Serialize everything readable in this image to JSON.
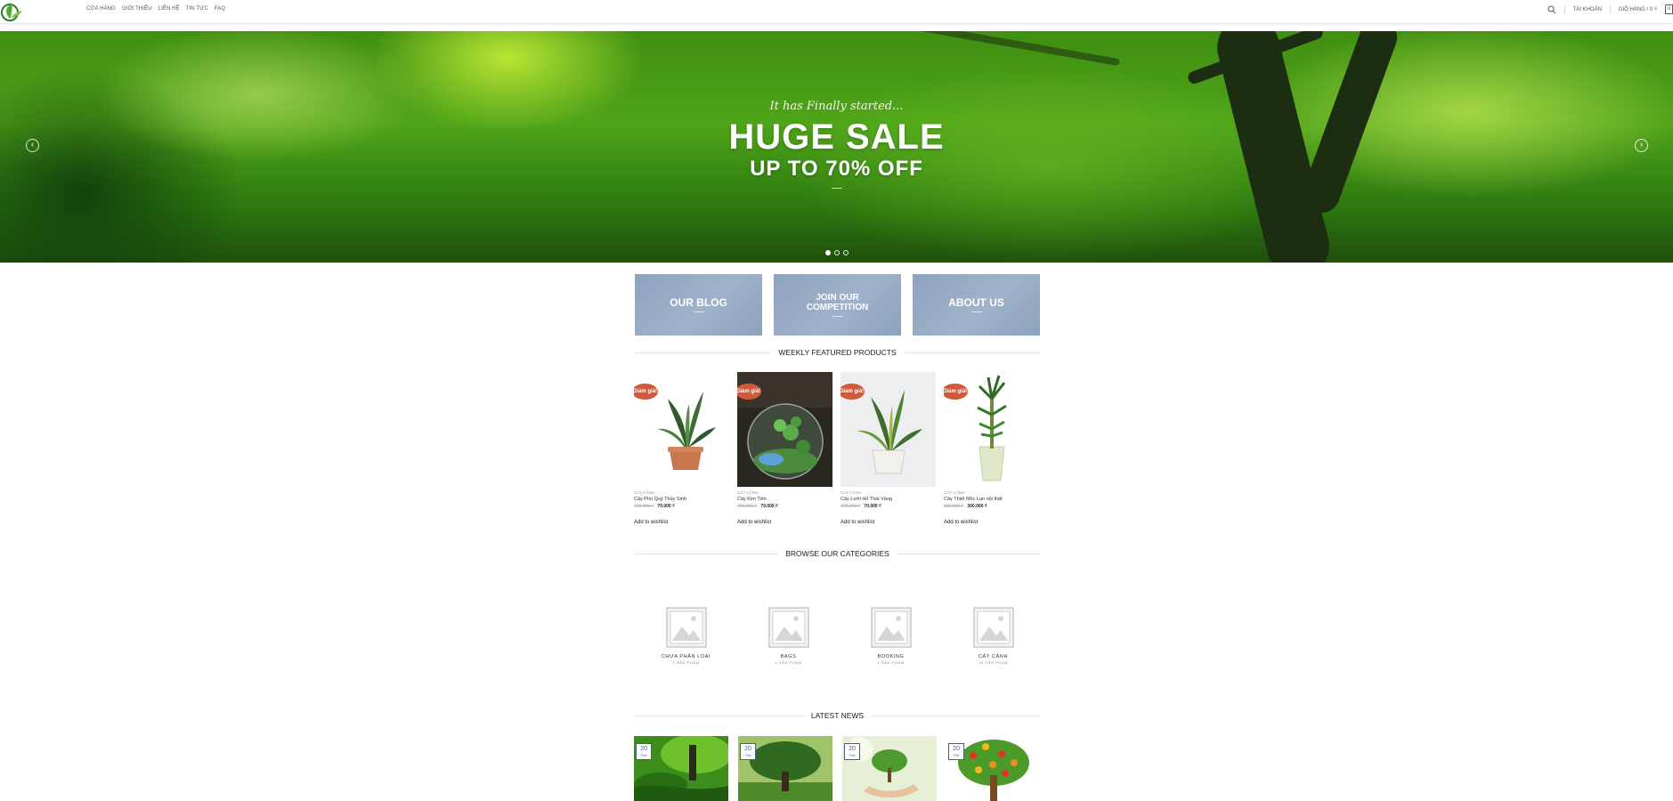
{
  "header": {
    "nav": [
      "CỬA HÀNG",
      "GIỚI THIỆU",
      "LIÊN HỆ",
      "TIN TỨC",
      "FAQ"
    ],
    "account_label": "TÀI KHOẢN",
    "cart_label": "GIỎ HÀNG / 0 ₫",
    "cart_count": "0"
  },
  "hero": {
    "tagline": "It has Finally started...",
    "title": "HUGE SALE",
    "subtitle": "UP TO 70% OFF",
    "prev_arrow": "‹",
    "next_arrow": "›",
    "slide_count": 3,
    "active_slide": 1
  },
  "banners": {
    "blog": "OUR BLOG",
    "competition_line1": "JOIN OUR",
    "competition_line2": "COMPETITION",
    "about": "ABOUT US"
  },
  "featured": {
    "title": "WEEKLY FEATURED PRODUCTS",
    "badge": "Giảm giá!",
    "wishlist_label": "Add to wishlist",
    "products": [
      {
        "category": "CÂY CẢNH",
        "name": "Cây Phú Quý Thủy Sinh",
        "old_price": "449.000 ₫",
        "new_price": "70.000 ₫"
      },
      {
        "category": "CÂY CẢNH",
        "name": "Cây Kim Tiền",
        "old_price": "440.000 ₫",
        "new_price": "70.000 ₫"
      },
      {
        "category": "CÂY CẢNH",
        "name": "Cây Lưỡi Hổ Thái Vàng",
        "old_price": "449.000 ₫",
        "new_price": "70.000 ₫"
      },
      {
        "category": "CÂY CẢNH",
        "name": "Cây Thiết Mộc Lan nội thất",
        "old_price": "650.000 ₫",
        "new_price": "300.000 ₫"
      }
    ]
  },
  "categories": {
    "title": "BROWSE OUR CATEGORIES",
    "items": [
      {
        "name": "CHƯA PHÂN LOẠI",
        "count": "2 SẢN PHẨM"
      },
      {
        "name": "BAGS",
        "count": "4 SẢN PHẨM"
      },
      {
        "name": "BOOKING",
        "count": "4 SẢN PHẨM"
      },
      {
        "name": "CÂY CẢNH",
        "count": "15 SẢN PHẨM"
      }
    ]
  },
  "news": {
    "title": "LATEST NEWS",
    "items": [
      {
        "day": "20",
        "month": "Th6"
      },
      {
        "day": "20",
        "month": "Th6"
      },
      {
        "day": "20",
        "month": "Th6"
      },
      {
        "day": "20",
        "month": "Th6"
      }
    ]
  },
  "colors": {
    "badge": "#d0593a",
    "banner": "#9aaec8",
    "date_border": "#446084",
    "logo_green": "#3c8d2f"
  }
}
